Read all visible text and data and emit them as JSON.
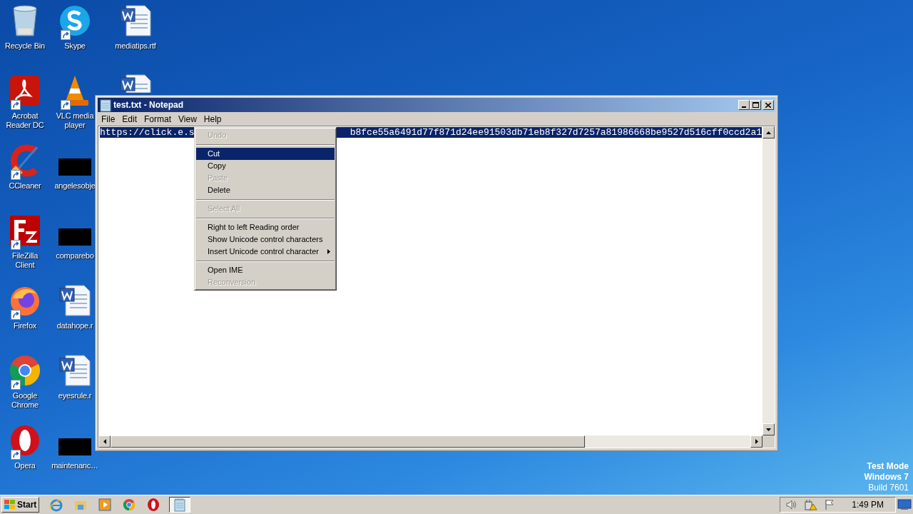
{
  "desktop_columns": [
    [
      {
        "kind": "recycle",
        "label": "Recycle Bin",
        "shortcut": false
      },
      {
        "kind": "acrobat",
        "label": "Acrobat Reader DC",
        "shortcut": true
      },
      {
        "kind": "ccleaner",
        "label": "CCleaner",
        "shortcut": true
      },
      {
        "kind": "filezilla",
        "label": "FileZilla Client",
        "shortcut": true
      },
      {
        "kind": "firefox",
        "label": "Firefox",
        "shortcut": true
      },
      {
        "kind": "chrome",
        "label": "Google Chrome",
        "shortcut": true
      },
      {
        "kind": "opera",
        "label": "Opera",
        "shortcut": true
      }
    ],
    [
      {
        "kind": "skype",
        "label": "Skype",
        "shortcut": true
      },
      {
        "kind": "vlc",
        "label": "VLC media player",
        "shortcut": true
      },
      {
        "kind": "redacted",
        "label": "angelesobje",
        "shortcut": false
      },
      {
        "kind": "redacted",
        "label": "comparebo",
        "shortcut": false
      },
      {
        "kind": "word",
        "label": "datahope.r",
        "shortcut": false
      },
      {
        "kind": "word",
        "label": "eyesrule.r",
        "shortcut": false
      },
      {
        "kind": "redacted",
        "label": "maintenanc…",
        "shortcut": false
      }
    ],
    [
      {
        "kind": "word",
        "label": "mediatips.rtf",
        "shortcut": false
      },
      {
        "kind": "word_partial",
        "shortcut": false
      }
    ]
  ],
  "window": {
    "title": "test.txt - Notepad",
    "menu": [
      "File",
      "Edit",
      "Format",
      "View",
      "Help"
    ],
    "text_left": "https://click.e.s",
    "text_right": "b8fce55a6491d77f871d24ee91503db71eb8f327d7257a81986668be9527d516cff0ccd2a1"
  },
  "context_menu": [
    {
      "kind": "item",
      "label": "Undo",
      "disabled": true,
      "selected": false
    },
    {
      "kind": "separator"
    },
    {
      "kind": "item",
      "label": "Cut",
      "disabled": false,
      "selected": true
    },
    {
      "kind": "item",
      "label": "Copy",
      "disabled": false,
      "selected": false
    },
    {
      "kind": "item",
      "label": "Paste",
      "disabled": true,
      "selected": false
    },
    {
      "kind": "item",
      "label": "Delete",
      "disabled": false,
      "selected": false
    },
    {
      "kind": "separator"
    },
    {
      "kind": "item",
      "label": "Select All",
      "disabled": true,
      "selected": false
    },
    {
      "kind": "separator"
    },
    {
      "kind": "item",
      "label": "Right to left Reading order",
      "disabled": false,
      "selected": false
    },
    {
      "kind": "item",
      "label": "Show Unicode control characters",
      "disabled": false,
      "selected": false
    },
    {
      "kind": "submenu",
      "label": "Insert Unicode control character",
      "disabled": false,
      "selected": false
    },
    {
      "kind": "separator"
    },
    {
      "kind": "item",
      "label": "Open IME",
      "disabled": false,
      "selected": false
    },
    {
      "kind": "item",
      "label": "Reconversion",
      "disabled": true,
      "selected": false
    }
  ],
  "os_notice": [
    "Test Mode",
    "Windows 7",
    "Build 7601"
  ],
  "taskbar": {
    "start": "Start",
    "quick_launch": [
      {
        "kind": "ie"
      },
      {
        "kind": "explorer"
      },
      {
        "kind": "player"
      },
      {
        "kind": "chrome"
      },
      {
        "kind": "opera"
      }
    ],
    "tasks": [
      {
        "kind": "notepad",
        "selected": true
      }
    ],
    "clock": "1:49 PM"
  }
}
